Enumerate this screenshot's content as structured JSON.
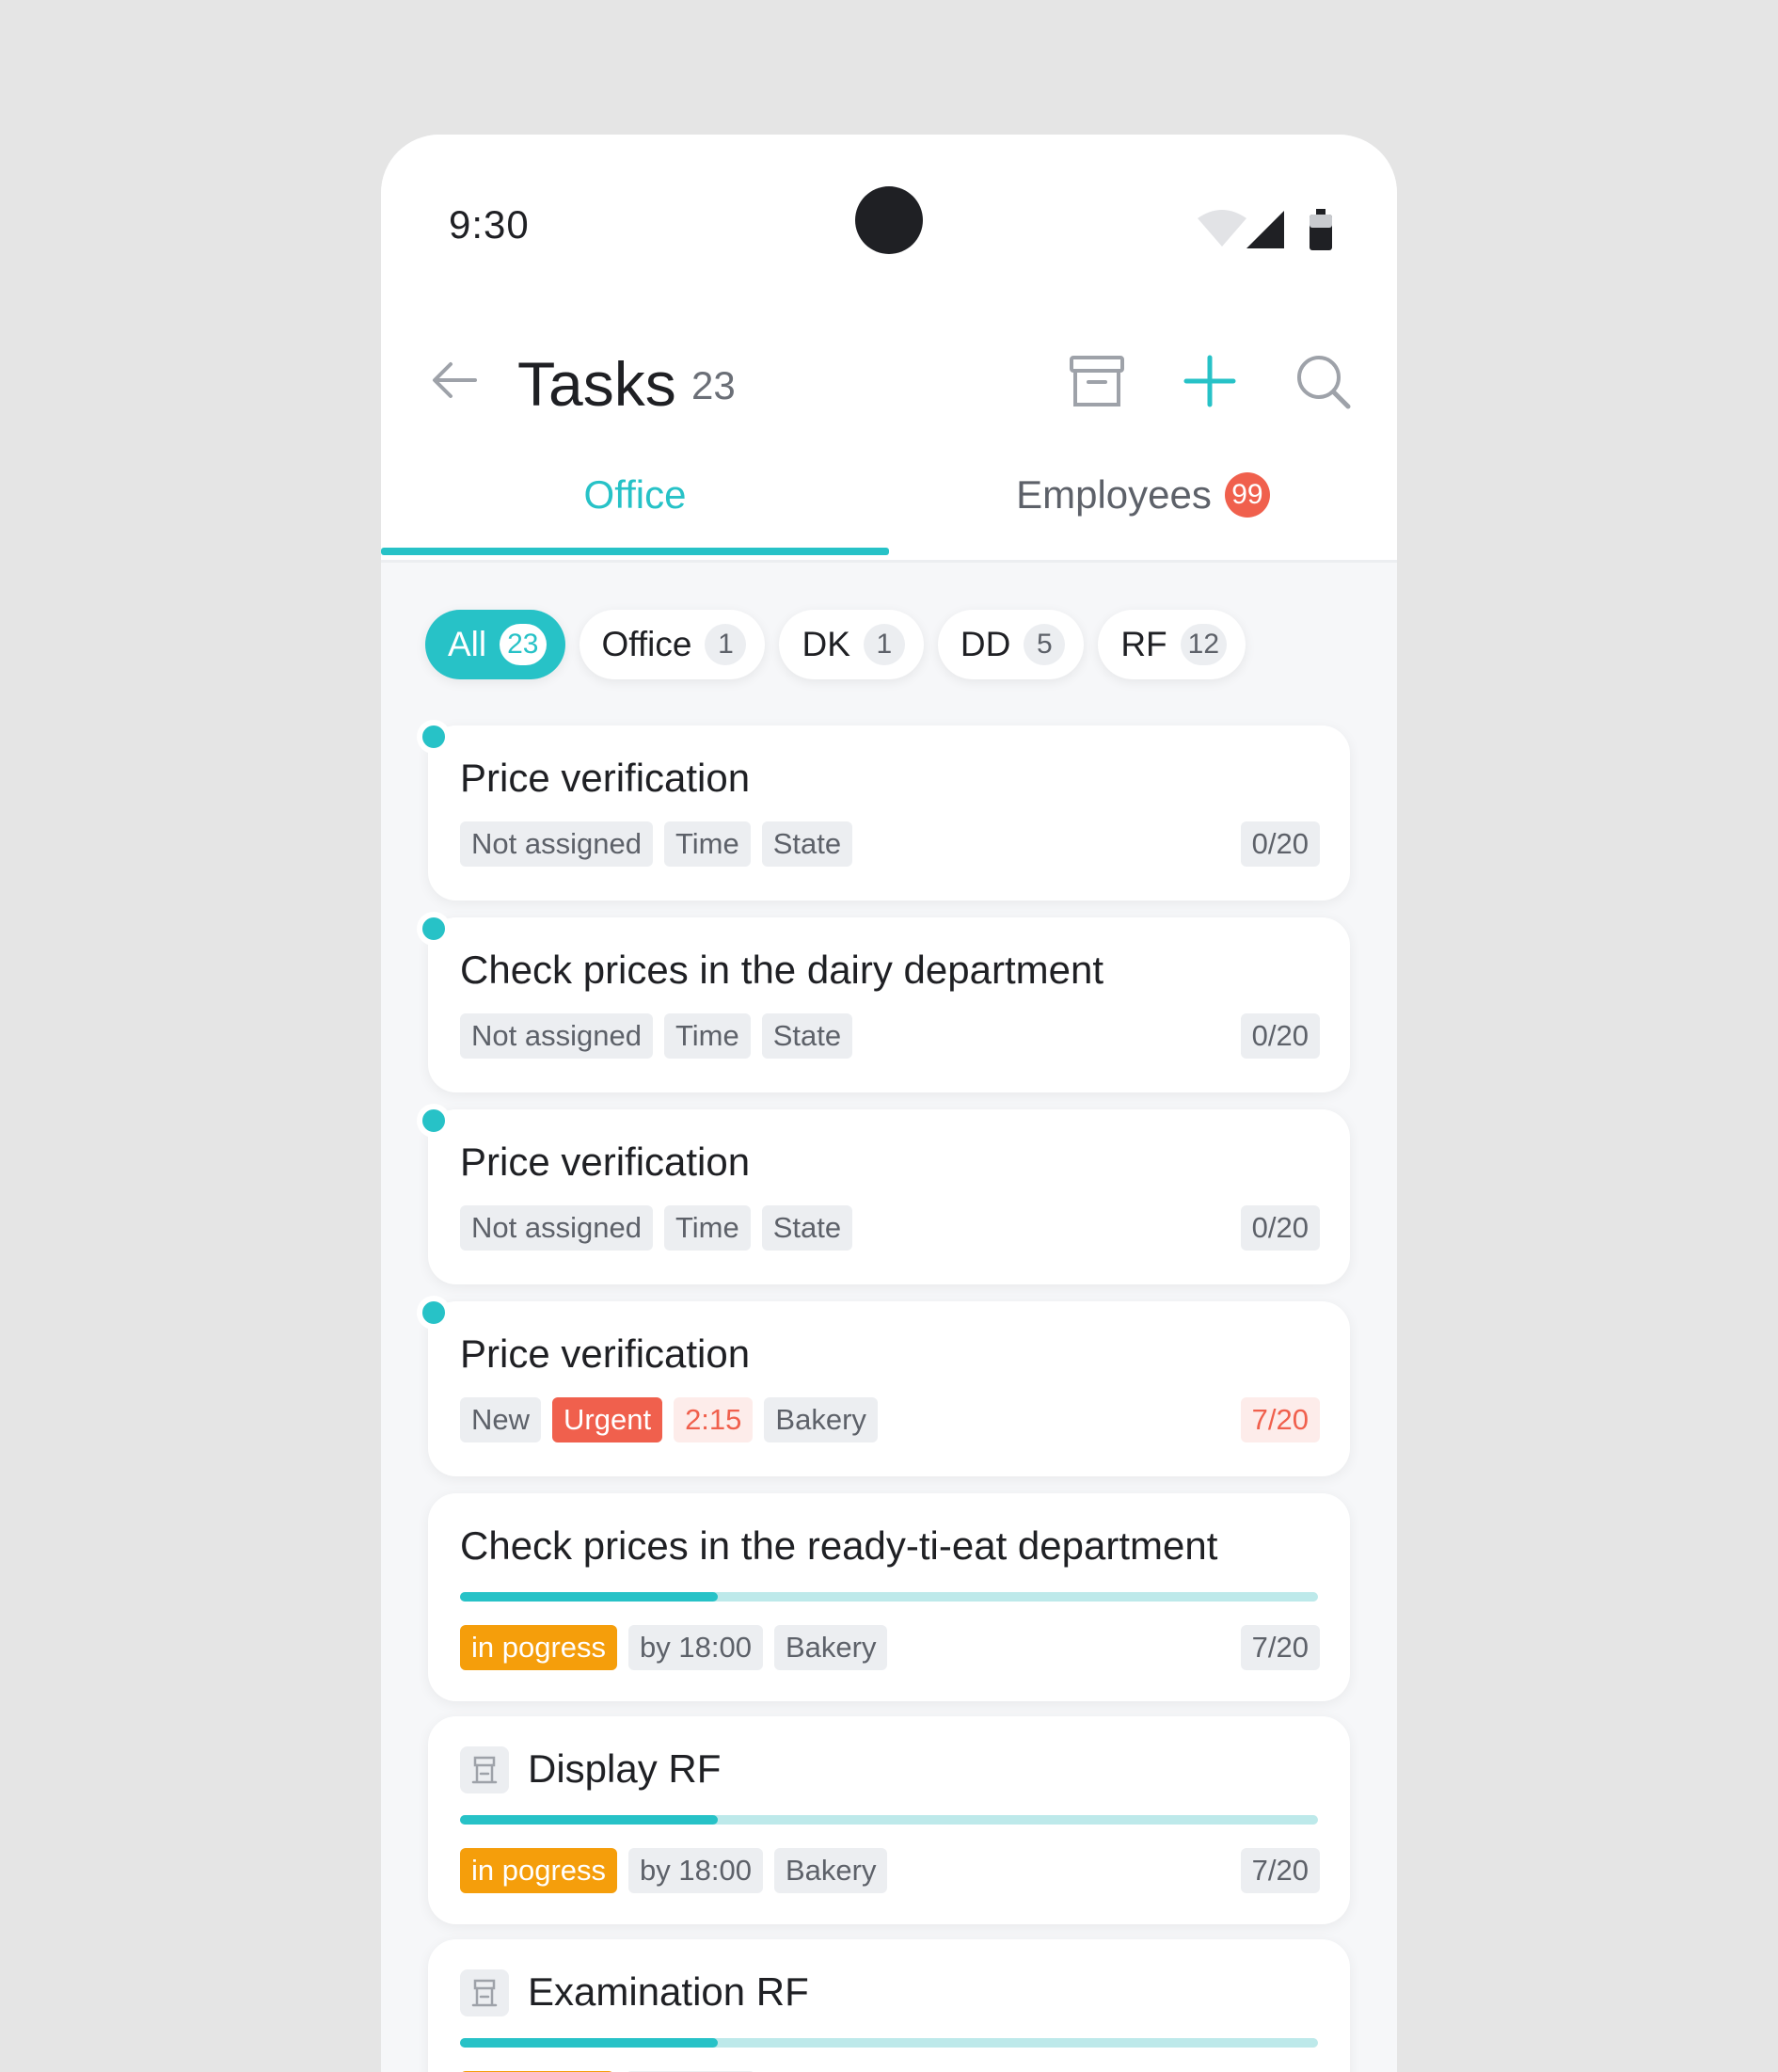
{
  "status_bar": {
    "time": "9:30"
  },
  "header": {
    "title": "Tasks",
    "count": "23"
  },
  "tabs": [
    {
      "label": "Office",
      "active": true
    },
    {
      "label": "Employees",
      "badge": "99",
      "active": false
    }
  ],
  "filters": [
    {
      "label": "All",
      "count": "23",
      "active": true
    },
    {
      "label": "Office",
      "count": "1",
      "active": false
    },
    {
      "label": "DK",
      "count": "1",
      "active": false
    },
    {
      "label": "DD",
      "count": "5",
      "active": false
    },
    {
      "label": "RF",
      "count": "12",
      "active": false
    }
  ],
  "tasks": [
    {
      "title": "Price verification",
      "tags": [
        "Not assigned",
        "Time",
        "State"
      ],
      "count": "0/20",
      "unread": true
    },
    {
      "title": "Check prices in the dairy department",
      "tags": [
        "Not assigned",
        "Time",
        "State"
      ],
      "count": "0/20",
      "unread": true
    },
    {
      "title": "Price verification",
      "tags": [
        "Not assigned",
        "Time",
        "State"
      ],
      "count": "0/20",
      "unread": true
    },
    {
      "title": "Price verification",
      "tags": [
        "New",
        "Urgent",
        "2:15",
        "Bakery"
      ],
      "count": "7/20",
      "unread": true
    },
    {
      "title": "Check prices in the ready-ti-eat department",
      "tags": [
        "in pogress",
        "by 18:00",
        "Bakery"
      ],
      "count": "7/20",
      "progress": 0.3
    },
    {
      "title": "Display RF",
      "icon": "store-icon",
      "tags": [
        "in pogress",
        "by 18:00",
        "Bakery"
      ],
      "count": "7/20",
      "progress": 0.3
    },
    {
      "title": "Examination RF",
      "icon": "store-icon",
      "progress": 0.3
    }
  ],
  "colors": {
    "accent": "#27c2c7",
    "urgent": "#f0604d",
    "progress": "#f59e0b"
  }
}
